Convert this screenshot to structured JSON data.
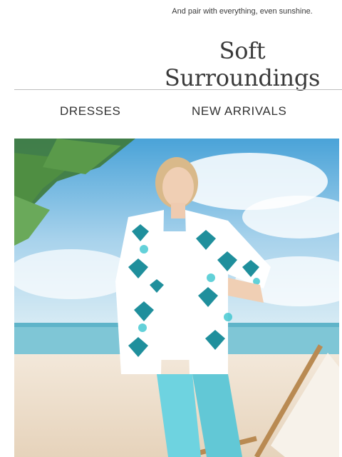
{
  "header": {
    "preheader_text": "And pair with everything, even sunshine.",
    "logo_text": "Soft Surroundings"
  },
  "nav": {
    "items": [
      {
        "label": "DRESSES"
      },
      {
        "label": "NEW ARRIVALS"
      }
    ]
  },
  "hero": {
    "description": "Model in teal ikat print shirt and turquoise pants on a beach with palm leaves and a lounge chair",
    "colors": {
      "sky_top": "#4aa3d8",
      "sky_bottom": "#cde6f3",
      "sea": "#7fc6d6",
      "sand": "#efe1cf",
      "shirt": "#ffffff",
      "print": "#1f8f9c",
      "pants": "#6ed3e0"
    }
  }
}
